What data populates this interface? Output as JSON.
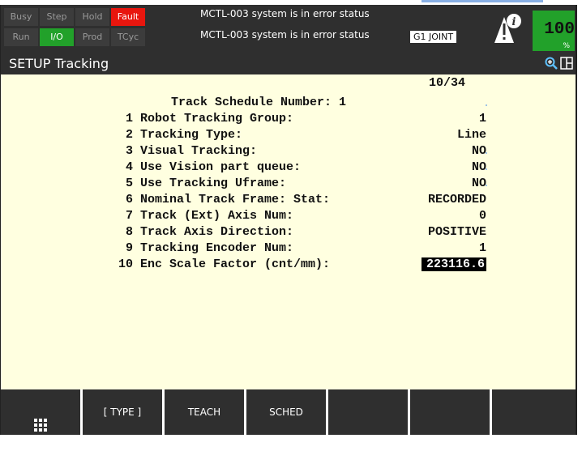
{
  "status": {
    "leds_row1": [
      {
        "label": "Busy",
        "state": "off"
      },
      {
        "label": "Step",
        "state": "off"
      },
      {
        "label": "Hold",
        "state": "off"
      },
      {
        "label": "Fault",
        "state": "red"
      }
    ],
    "leds_row2": [
      {
        "label": "Run",
        "state": "off"
      },
      {
        "label": "I/O",
        "state": "green"
      },
      {
        "label": "Prod",
        "state": "off"
      },
      {
        "label": "TCyc",
        "state": "off"
      }
    ],
    "message1": "MCTL-003 system is in error status",
    "message2": "MCTL-003 system is in error status",
    "coord_mode": "G1 JOINT",
    "speed_value": "100",
    "speed_unit": "%"
  },
  "title_bar": {
    "title": "SETUP Tracking"
  },
  "screen": {
    "page_counter": "10/34",
    "header": "Track Schedule Number: 1",
    "items": [
      {
        "num": "1",
        "label": "Robot Tracking Group:",
        "value": "1"
      },
      {
        "num": "2",
        "label": "Tracking Type:",
        "value": "Line"
      },
      {
        "num": "3",
        "label": "Visual Tracking:",
        "value": "NO"
      },
      {
        "num": "4",
        "label": "Use Vision part queue:",
        "value": "NO"
      },
      {
        "num": "5",
        "label": "Use Tracking Uframe:",
        "value": "NO"
      },
      {
        "num": "6",
        "label": "Nominal Track Frame: Stat:",
        "value": "RECORDED"
      },
      {
        "num": "7",
        "label": "Track (Ext) Axis Num:",
        "value": "0"
      },
      {
        "num": "8",
        "label": "Track Axis Direction:",
        "value": "POSITIVE"
      },
      {
        "num": "9",
        "label": "Tracking Encoder Num:",
        "value": "1"
      },
      {
        "num": "10",
        "label": "Enc Scale Factor (cnt/mm):",
        "value": "223116.6"
      }
    ]
  },
  "function_keys": [
    "",
    "[ TYPE ]",
    "TEACH",
    "SCHED",
    "",
    "",
    ""
  ],
  "icons": {
    "info": "info-warning-icon",
    "zoom": "zoom-in-icon",
    "split": "split-window-icon",
    "menu": "grid-menu-icon"
  },
  "colors": {
    "background": "#ffffe0",
    "bar": "#2f2f2f",
    "fault": "#e8160e",
    "active_green": "#22a12a"
  }
}
